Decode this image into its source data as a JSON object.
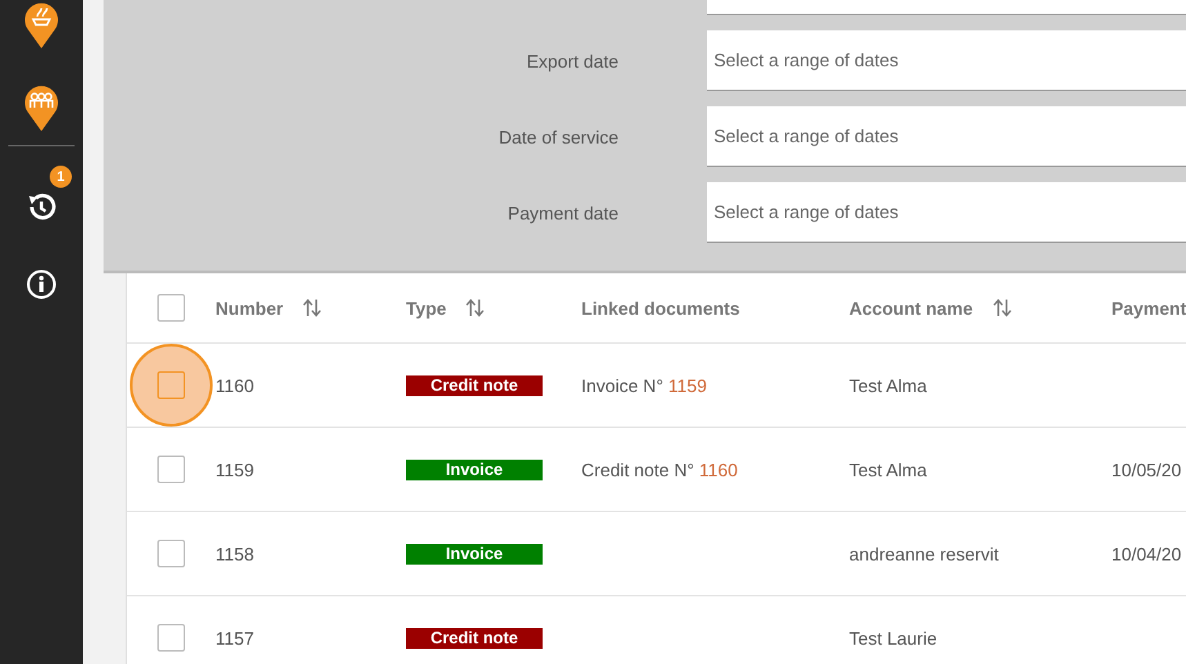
{
  "sidebar": {
    "history_badge": "1"
  },
  "filters": [
    {
      "label": "Export date",
      "placeholder": "Select a range of dates"
    },
    {
      "label": "Date of service",
      "placeholder": "Select a range of dates"
    },
    {
      "label": "Payment date",
      "placeholder": "Select a range of dates"
    }
  ],
  "table": {
    "select_all_checked": false,
    "columns": [
      {
        "label": "Number",
        "sortable": true
      },
      {
        "label": "Type",
        "sortable": true
      },
      {
        "label": "Linked documents",
        "sortable": false
      },
      {
        "label": "Account name",
        "sortable": true
      },
      {
        "label": "Payment",
        "sortable": false
      }
    ],
    "rows": [
      {
        "checked": false,
        "number": "1160",
        "type": "Credit note",
        "color": "#9b0000",
        "linked_prefix": "Invoice N°",
        "linked_number": "1159",
        "account": "Test Alma",
        "payment": "",
        "highlighted": true
      },
      {
        "checked": false,
        "number": "1159",
        "type": "Invoice",
        "color": "#008000",
        "linked_prefix": "Credit note N°",
        "linked_number": "1160",
        "account": "Test Alma",
        "payment": "10/05/20",
        "highlighted": false
      },
      {
        "checked": false,
        "number": "1158",
        "type": "Invoice",
        "color": "#008000",
        "linked_prefix": "",
        "linked_number": "",
        "account": "andreanne reservit",
        "payment": "10/04/20",
        "highlighted": false
      },
      {
        "checked": false,
        "number": "1157",
        "type": "Credit note",
        "color": "#9b0000",
        "linked_prefix": "",
        "linked_number": "",
        "account": "Test Laurie",
        "payment": "",
        "highlighted": false
      }
    ]
  }
}
